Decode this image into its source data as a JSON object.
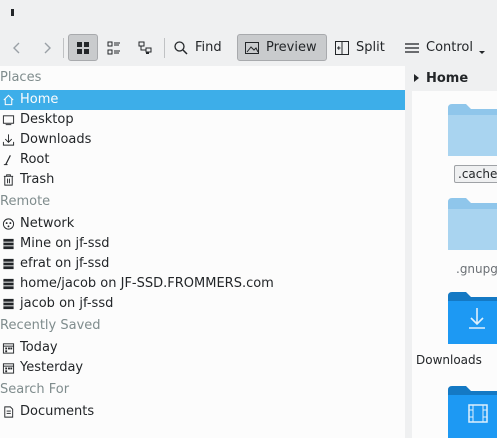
{
  "toolbar": {
    "find_label": "Find",
    "preview_label": "Preview",
    "split_label": "Split",
    "control_label": "Control"
  },
  "places": {
    "sections": [
      {
        "title": "Places",
        "items": [
          {
            "label": "Home",
            "icon": "home-icon"
          },
          {
            "label": "Desktop",
            "icon": "desktop-icon"
          },
          {
            "label": "Downloads",
            "icon": "download-icon"
          },
          {
            "label": "Root",
            "icon": "root-icon"
          },
          {
            "label": "Trash",
            "icon": "trash-icon"
          }
        ]
      },
      {
        "title": "Remote",
        "items": [
          {
            "label": "Network",
            "icon": "network-icon"
          },
          {
            "label": "Mine on jf-ssd",
            "icon": "server-icon"
          },
          {
            "label": "efrat on jf-ssd",
            "icon": "server-icon"
          },
          {
            "label": "home/jacob on JF-SSD.FROMMERS.com",
            "icon": "server-icon"
          },
          {
            "label": "jacob on jf-ssd",
            "icon": "server-icon"
          }
        ]
      },
      {
        "title": "Recently Saved",
        "items": [
          {
            "label": "Today",
            "icon": "calendar-icon"
          },
          {
            "label": "Yesterday",
            "icon": "calendar-icon"
          }
        ]
      },
      {
        "title": "Search For",
        "items": [
          {
            "label": "Documents",
            "icon": "document-icon"
          }
        ]
      }
    ],
    "selected": "Home"
  },
  "breadcrumb": {
    "current": "Home"
  },
  "files": [
    {
      "name": ".cache",
      "icon": "folder-icon"
    },
    {
      "name": ".gnupg",
      "icon": "folder-icon"
    },
    {
      "name": "Downloads",
      "icon": "folder-download-icon"
    },
    {
      "name": "",
      "icon": "folder-videos-icon"
    }
  ],
  "colors": {
    "selection": "#3daee9",
    "folder_light": "#8fc6eb",
    "folder_dark": "#1d99f3",
    "window_bg": "#eff0f1",
    "view_bg": "#fcfcfc"
  }
}
